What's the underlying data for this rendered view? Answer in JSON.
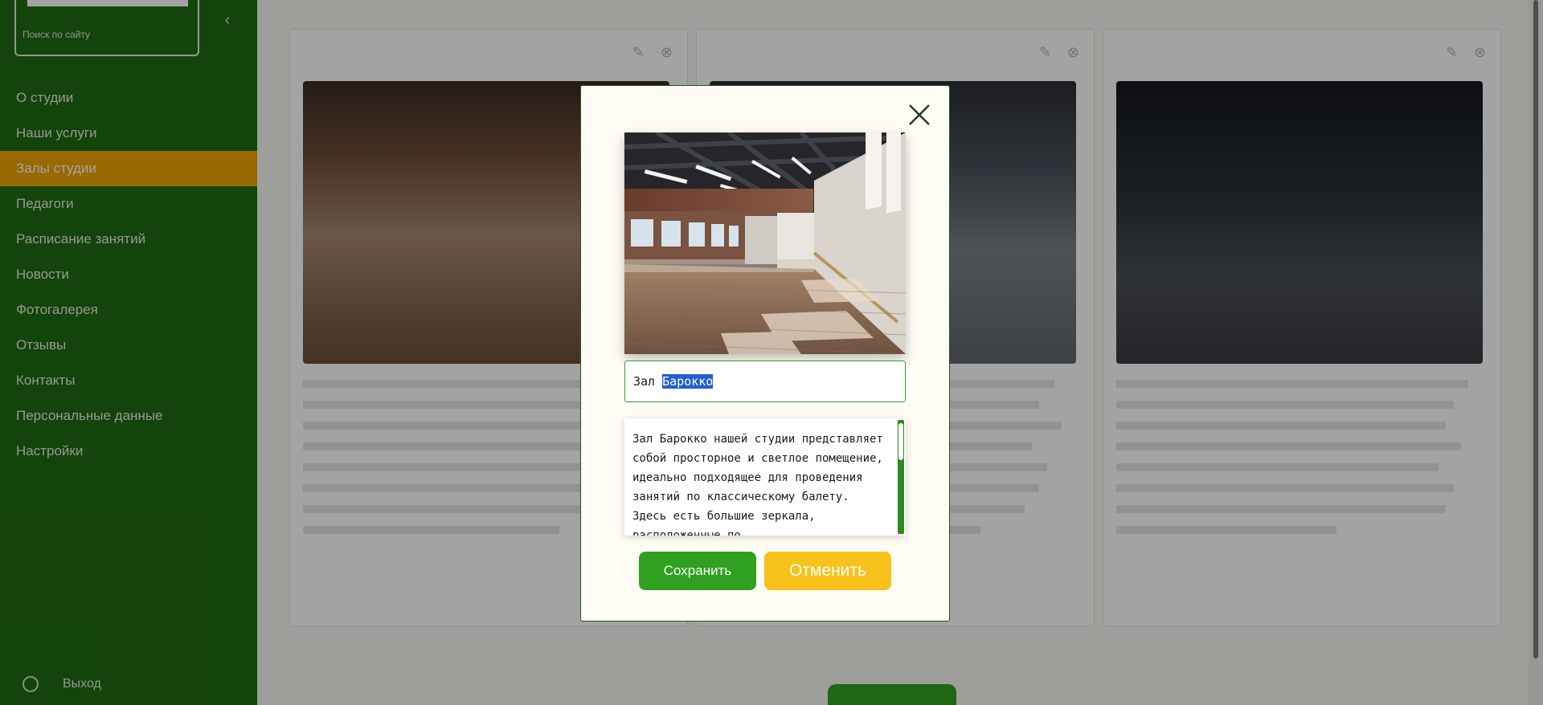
{
  "sidebar": {
    "search_hint": "Поиск по сайту",
    "items": [
      {
        "label": "О студии"
      },
      {
        "label": "Наши услуги"
      },
      {
        "label": "Залы студии",
        "active": true
      },
      {
        "label": "Педагоги"
      },
      {
        "label": "Расписание занятий"
      },
      {
        "label": "Новости"
      },
      {
        "label": "Фотогалерея"
      },
      {
        "label": "Отзывы"
      },
      {
        "label": "Контакты"
      },
      {
        "label": "Персональные данные"
      },
      {
        "label": "Настройки"
      }
    ],
    "footer_label": "Выход"
  },
  "modal": {
    "title_value_prefix": "Зал ",
    "title_value_selected": "Барокко",
    "description": "Зал Барокко нашей студии представляет собой просторное и светлое помещение, идеально подходящее для проведения занятий по классическому балету. Здесь есть большие зеркала, расположенные по",
    "save_label": "Сохранить",
    "cancel_label": "Отменить"
  },
  "colors": {
    "sidebar": "#1f6b12",
    "active_nav": "#f0a700",
    "save_button": "#2fa01f",
    "cancel_button": "#f7c21a",
    "input_border": "#3aa02a",
    "selection": "#1f5fd0"
  },
  "icons": {
    "close": "close-icon",
    "card_edit": "edit-icon",
    "card_delete": "delete-icon"
  }
}
